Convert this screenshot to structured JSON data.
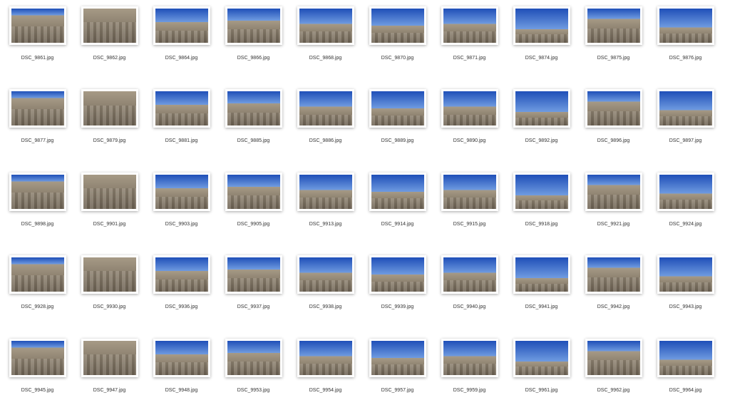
{
  "files": [
    "DSC_9861.jpg",
    "DSC_9862.jpg",
    "DSC_9864.jpg",
    "DSC_9866.jpg",
    "DSC_9868.jpg",
    "DSC_9870.jpg",
    "DSC_9871.jpg",
    "DSC_9874.jpg",
    "DSC_9875.jpg",
    "DSC_9876.jpg",
    "DSC_9877.jpg",
    "DSC_9879.jpg",
    "DSC_9881.jpg",
    "DSC_9885.jpg",
    "DSC_9886.jpg",
    "DSC_9889.jpg",
    "DSC_9890.jpg",
    "DSC_9892.jpg",
    "DSC_9896.jpg",
    "DSC_9897.jpg",
    "DSC_9898.jpg",
    "DSC_9901.jpg",
    "DSC_9903.jpg",
    "DSC_9905.jpg",
    "DSC_9913.jpg",
    "DSC_9914.jpg",
    "DSC_9915.jpg",
    "DSC_9918.jpg",
    "DSC_9921.jpg",
    "DSC_9924.jpg",
    "DSC_9928.jpg",
    "DSC_9930.jpg",
    "DSC_9936.jpg",
    "DSC_9937.jpg",
    "DSC_9938.jpg",
    "DSC_9939.jpg",
    "DSC_9940.jpg",
    "DSC_9941.jpg",
    "DSC_9942.jpg",
    "DSC_9943.jpg",
    "DSC_9945.jpg",
    "DSC_9947.jpg",
    "DSC_9948.jpg",
    "DSC_9953.jpg",
    "DSC_9954.jpg",
    "DSC_9957.jpg",
    "DSC_9959.jpg",
    "DSC_9961.jpg",
    "DSC_9962.jpg",
    "DSC_9964.jpg"
  ],
  "colors": {
    "sky": "#2f62c8",
    "stone": "#a69a86",
    "dark_stone": "#6e6354"
  }
}
